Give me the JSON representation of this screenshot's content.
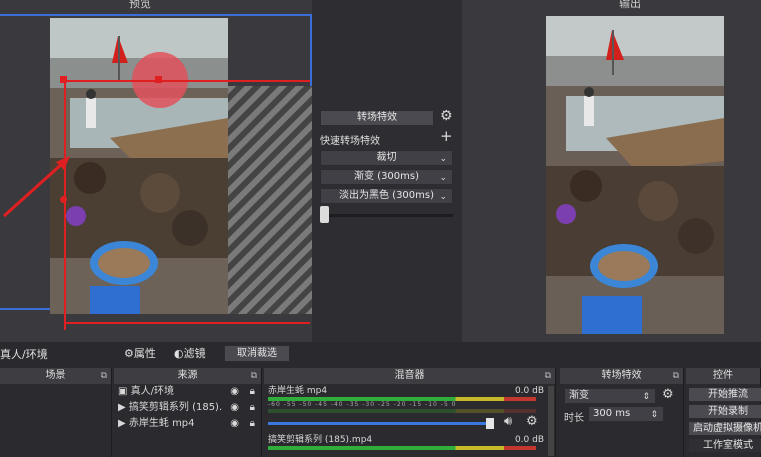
{
  "panels": {
    "preview_title": "预览",
    "output_title": "输出"
  },
  "transition_panel": {
    "transition_label": "转场特效",
    "quick_transitions_label": "快速转场特效",
    "options": [
      "裁切",
      "渐变 (300ms)",
      "淡出为黑色 (300ms)"
    ]
  },
  "scene_bar": {
    "current_scene": "真人/环境",
    "properties_label": "属性",
    "filters_label": "滤镜",
    "cancel_label": "取消裁选"
  },
  "docks": {
    "scenes": {
      "title": "场景"
    },
    "sources": {
      "title": "来源",
      "items": [
        {
          "name": "真人/环境"
        },
        {
          "name": "搞笑剪辑系列 (185)."
        },
        {
          "name": "赤岸生蚝 mp4"
        }
      ]
    },
    "mixer": {
      "title": "混音器",
      "tracks": [
        {
          "name": "赤岸生蚝 mp4",
          "level": "0.0 dB"
        },
        {
          "name": "搞笑剪辑系列 (185).mp4",
          "level": "0.0 dB"
        }
      ],
      "scale": "-60 -55 -50 -45 -40 -35 -30 -25 -20 -15 -10 -5 0"
    },
    "transitions": {
      "title": "转场特效",
      "selected": "渐变",
      "duration_label": "时长",
      "duration_value": "300 ms"
    },
    "controls": {
      "title": "控件",
      "buttons": [
        "开始推流",
        "开始录制",
        "启动虚拟摄像机",
        "工作室模式"
      ]
    }
  },
  "colors": {
    "accent_blue": "#3a6fd8",
    "crop_red": "#e02020"
  }
}
